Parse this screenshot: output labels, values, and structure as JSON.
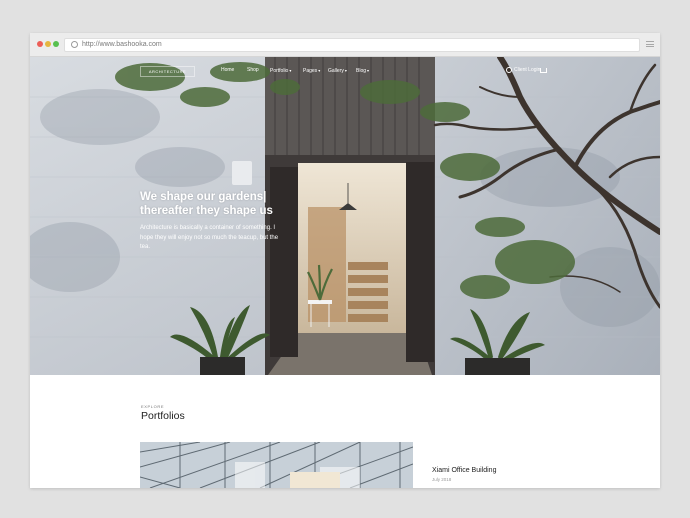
{
  "browser": {
    "url": "http://www.bashooka.com"
  },
  "nav": {
    "logo": "ARCHITECTURE",
    "items": [
      {
        "label": "Home",
        "has_dropdown": false
      },
      {
        "label": "Shop",
        "has_dropdown": false
      },
      {
        "label": "Portfolio",
        "has_dropdown": true
      },
      {
        "label": "Pages",
        "has_dropdown": true
      },
      {
        "label": "Gallery",
        "has_dropdown": true
      },
      {
        "label": "Blog",
        "has_dropdown": true
      }
    ],
    "login_label": "Client Login",
    "caret": "▾"
  },
  "hero": {
    "headline_line1": "We shape our gardens|",
    "headline_line2": "thereafter they shape us",
    "body": "Architecture is basically a container of something. I hope they will enjoy not so much the teacup, but the tea."
  },
  "section": {
    "eyebrow": "EXPLORE",
    "title": "Portfolios"
  },
  "portfolio": {
    "project_title": "Xiami Office Building",
    "project_date": "July 2018"
  },
  "colors": {
    "window_bg": "#e1e1e1",
    "hero_wall": "#c4c9cf",
    "door_frame": "#3f3a39"
  },
  "icons": [
    "info-icon",
    "menu-icon",
    "user-icon",
    "cart-icon",
    "chevron-down-icon"
  ]
}
